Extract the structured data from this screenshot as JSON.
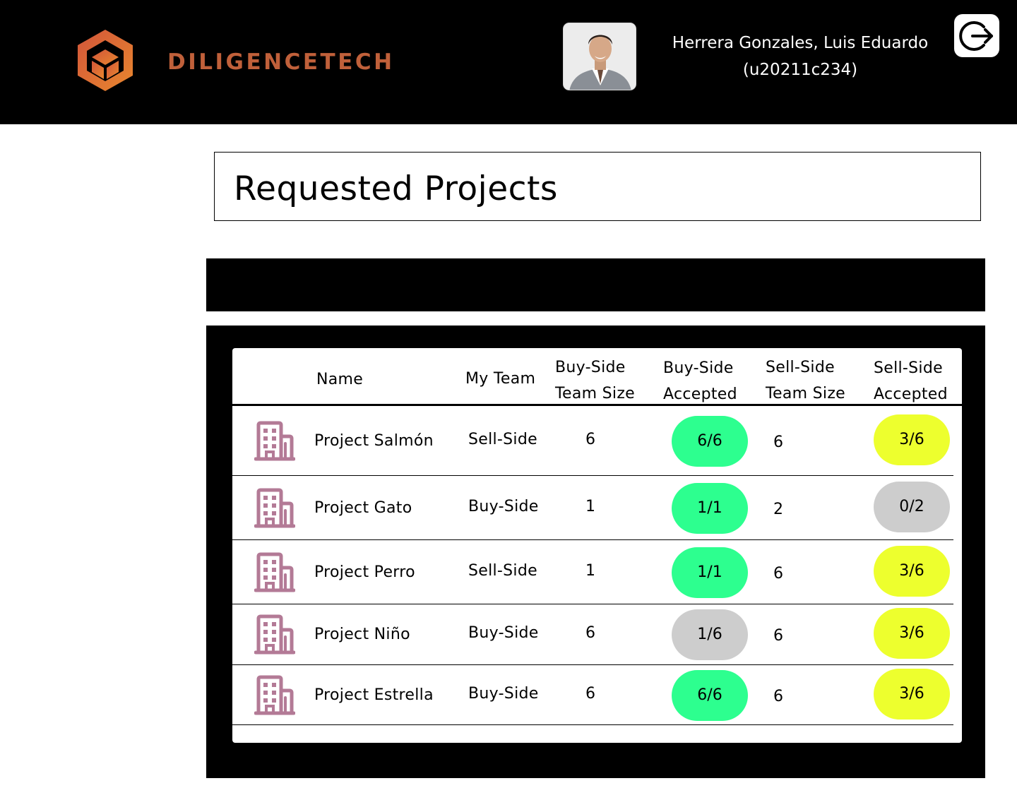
{
  "header": {
    "brand": "DILIGENCETECH",
    "user_name": "Herrera Gonzales, Luis Eduardo",
    "user_code": "(u20211c234)",
    "logo_icon": "cube-logo-icon",
    "logout_icon": "logout-icon",
    "brand_color": "#c0603a"
  },
  "page": {
    "title": "Requested Projects"
  },
  "table": {
    "columns": {
      "name": "Name",
      "my_team": "My Team",
      "buy_size_1": "Buy-Side",
      "buy_size_2": "Team Size",
      "buy_acc_1": "Buy-Side",
      "buy_acc_2": "Accepted",
      "sell_size_1": "Sell-Side",
      "sell_size_2": "Team Size",
      "sell_acc_1": "Sell-Side",
      "sell_acc_2": "Accepted"
    },
    "rows": [
      {
        "name": "Project Salmón",
        "my_team": "Sell-Side",
        "buy_size": "6",
        "buy_accepted": "6/6",
        "buy_status": "green",
        "sell_size": "6",
        "sell_accepted": "3/6",
        "sell_status": "yellow"
      },
      {
        "name": "Project Gato",
        "my_team": "Buy-Side",
        "buy_size": "1",
        "buy_accepted": "1/1",
        "buy_status": "green",
        "sell_size": "2",
        "sell_accepted": "0/2",
        "sell_status": "grey"
      },
      {
        "name": "Project Perro",
        "my_team": "Sell-Side",
        "buy_size": "1",
        "buy_accepted": "1/1",
        "buy_status": "green",
        "sell_size": "6",
        "sell_accepted": "3/6",
        "sell_status": "yellow"
      },
      {
        "name": "Project Niño",
        "my_team": "Buy-Side",
        "buy_size": "6",
        "buy_accepted": "1/6",
        "buy_status": "grey",
        "sell_size": "6",
        "sell_accepted": "3/6",
        "sell_status": "yellow"
      },
      {
        "name": "Project Estrella",
        "my_team": "Buy-Side",
        "buy_size": "6",
        "buy_accepted": "6/6",
        "buy_status": "green",
        "sell_size": "6",
        "sell_accepted": "3/6",
        "sell_status": "yellow"
      }
    ],
    "row_icon": "building-icon",
    "status_colors": {
      "green": "#2dff8f",
      "yellow": "#edff2e",
      "grey": "#cdcdcd"
    }
  }
}
